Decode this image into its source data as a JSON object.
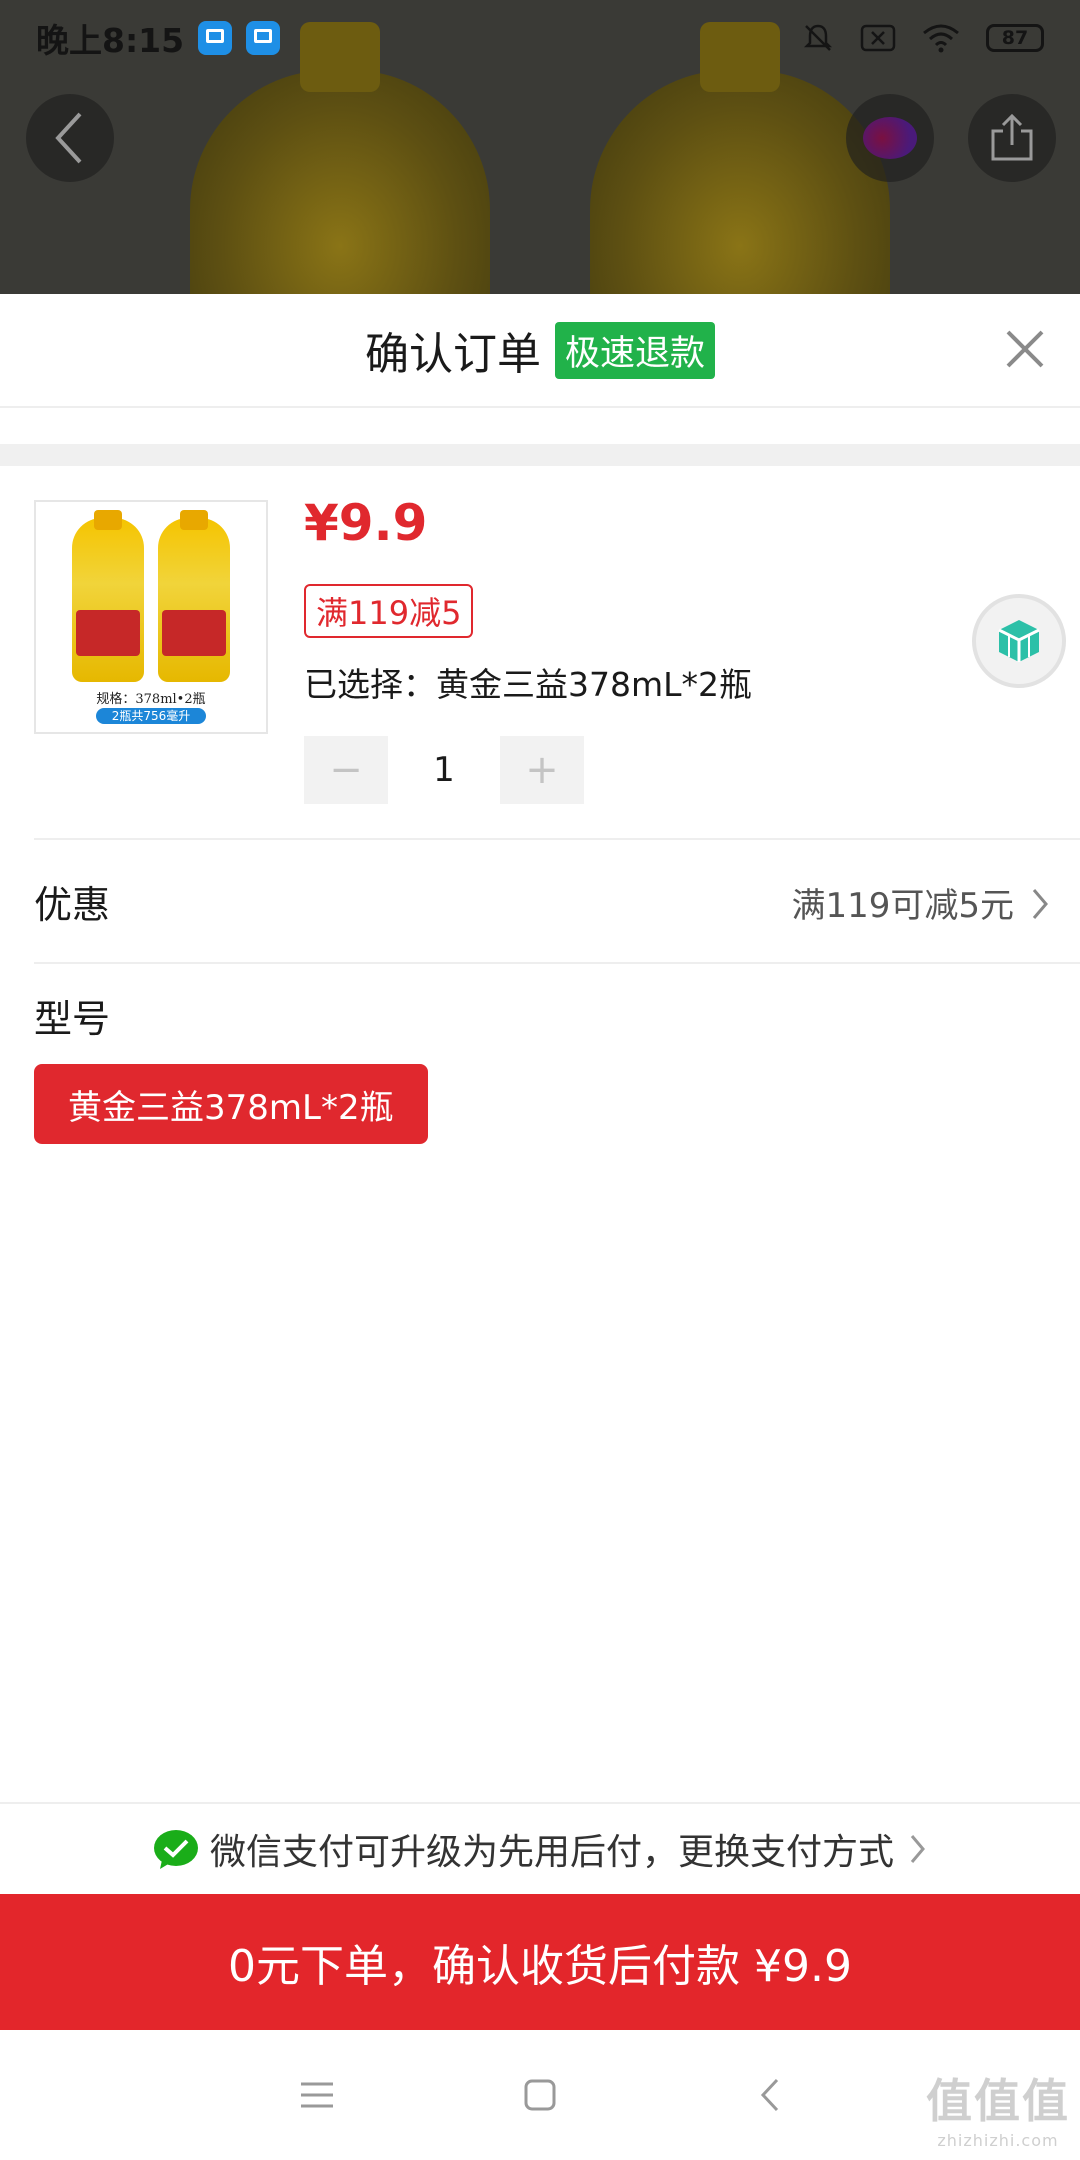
{
  "status_bar": {
    "time": "晚上8:15",
    "battery": "87"
  },
  "sheet": {
    "title": "确认订单",
    "badge": "极速退款"
  },
  "product": {
    "image_spec_text": "规格：378ml•2瓶",
    "image_pill_text": "2瓶共756毫升",
    "price": "¥9.9",
    "coupon_tag": "满119减5",
    "selected_text": "已选择：黄金三益378mL*2瓶",
    "quantity": "1",
    "minus_symbol": "−",
    "plus_symbol": "+"
  },
  "promotion": {
    "label": "优惠",
    "value": "满119可减5元"
  },
  "model": {
    "label": "型号",
    "option": "黄金三益378mL*2瓶"
  },
  "payment": {
    "text": "微信支付可升级为先用后付，更换支付方式"
  },
  "cta": {
    "label": "0元下单，确认收货后付款 ¥9.9"
  },
  "watermark": {
    "big": "值值值",
    "small": "zhizhizhi.com"
  },
  "colors": {
    "accent_red": "#e0282e",
    "refund_green": "#21b24a"
  }
}
